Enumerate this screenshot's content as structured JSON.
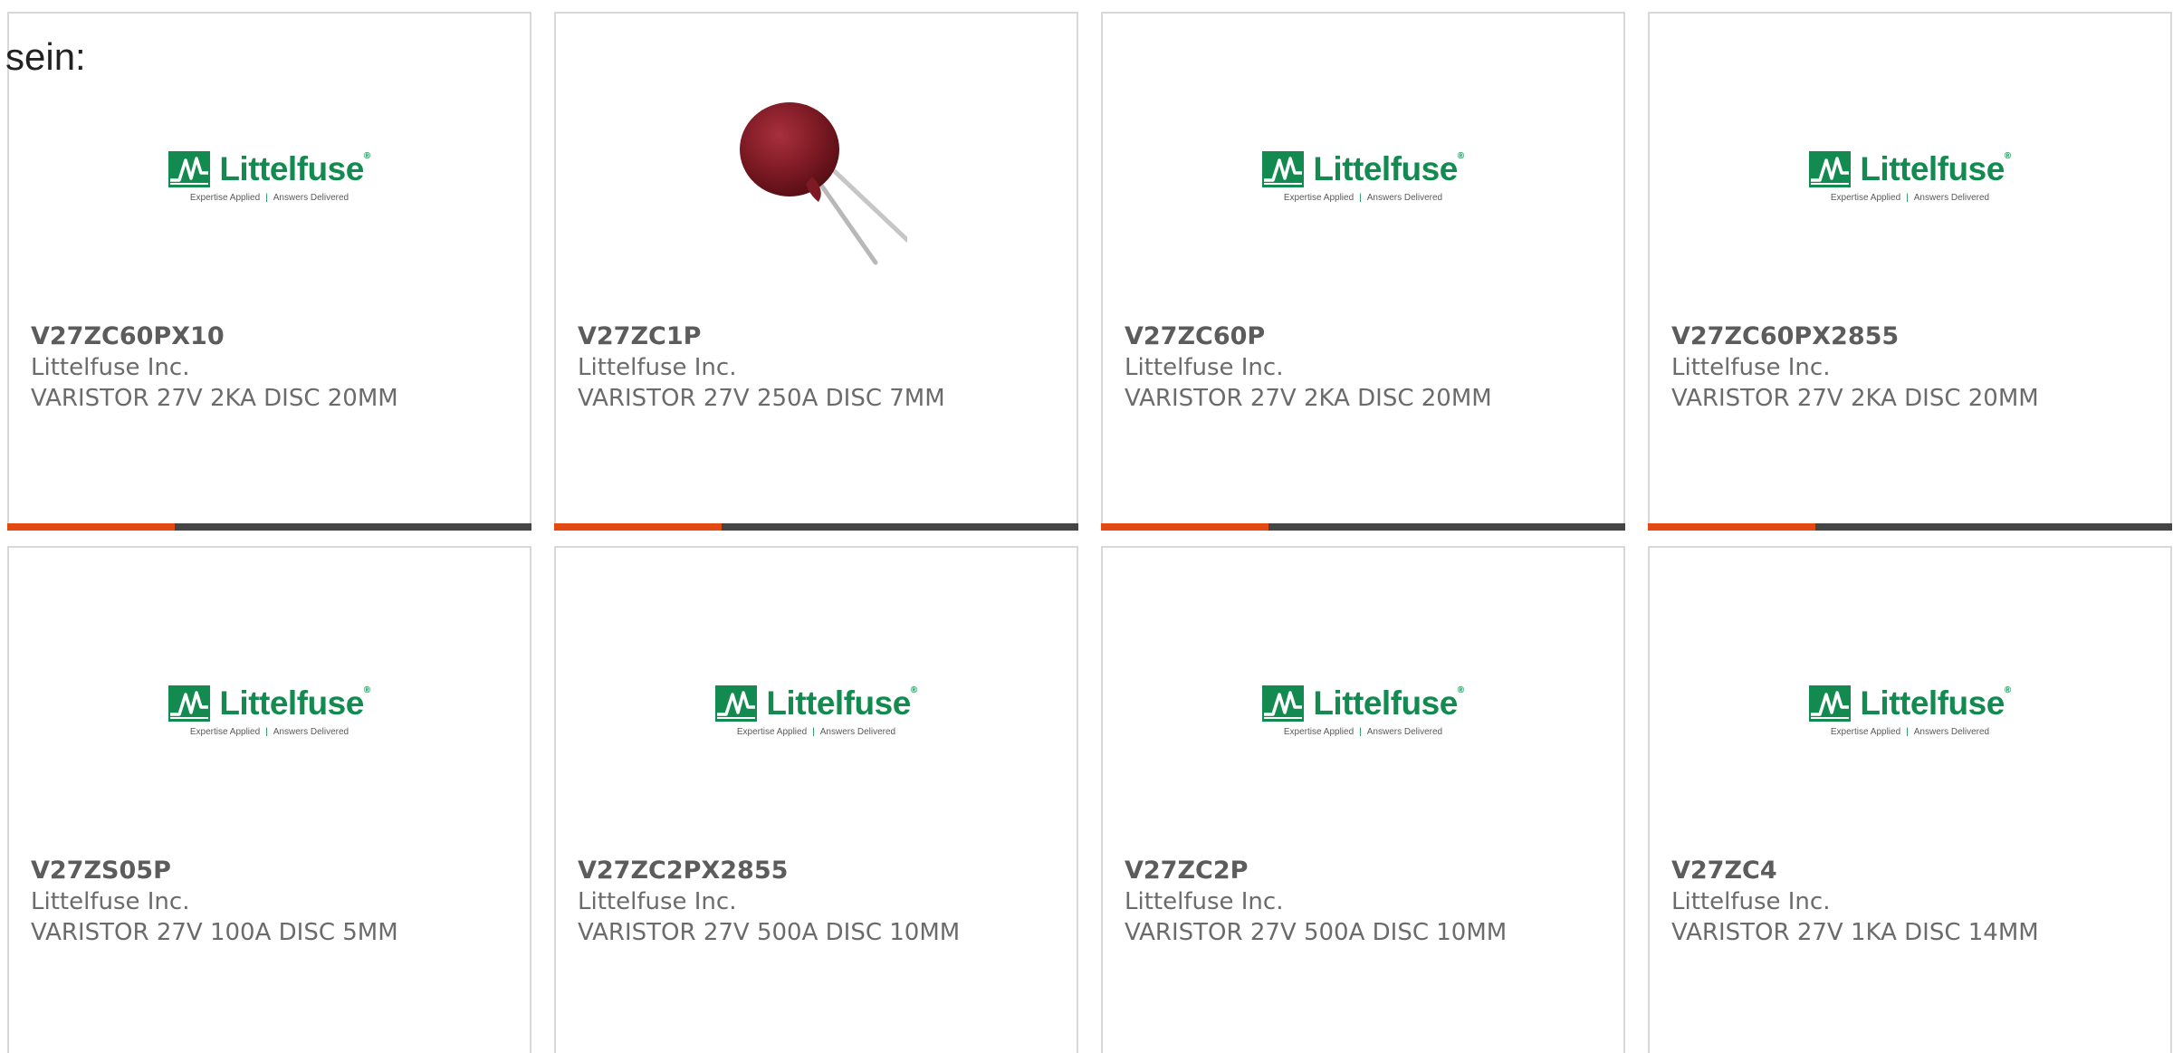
{
  "intro_text": "sein:",
  "colors": {
    "accent": "#e34a13",
    "bar": "#454545",
    "brand_green": "#138a4f",
    "border": "#d8d8d8"
  },
  "logo": {
    "wordmark": "Littelfuse",
    "registered": "®",
    "tagline_left": "Expertise Applied",
    "tagline_sep": "|",
    "tagline_right": "Answers Delivered"
  },
  "products": [
    {
      "part_number": "V27ZC60PX10",
      "manufacturer": "Littelfuse Inc.",
      "description": "VARISTOR 27V 2KA DISC 20MM",
      "image": "littelfuse-logo",
      "progress": 0.32
    },
    {
      "part_number": "V27ZC1P",
      "manufacturer": "Littelfuse Inc.",
      "description": "VARISTOR 27V 250A DISC 7MM",
      "image": "varistor-photo",
      "progress": 0.32
    },
    {
      "part_number": "V27ZC60P",
      "manufacturer": "Littelfuse Inc.",
      "description": "VARISTOR 27V 2KA DISC 20MM",
      "image": "littelfuse-logo",
      "progress": 0.32
    },
    {
      "part_number": "V27ZC60PX2855",
      "manufacturer": "Littelfuse Inc.",
      "description": "VARISTOR 27V 2KA DISC 20MM",
      "image": "littelfuse-logo",
      "progress": 0.32
    },
    {
      "part_number": "V27ZS05P",
      "manufacturer": "Littelfuse Inc.",
      "description": "VARISTOR 27V 100A DISC 5MM",
      "image": "littelfuse-logo"
    },
    {
      "part_number": "V27ZC2PX2855",
      "manufacturer": "Littelfuse Inc.",
      "description": "VARISTOR 27V 500A DISC 10MM",
      "image": "littelfuse-logo"
    },
    {
      "part_number": "V27ZC2P",
      "manufacturer": "Littelfuse Inc.",
      "description": "VARISTOR 27V 500A DISC 10MM",
      "image": "littelfuse-logo"
    },
    {
      "part_number": "V27ZC4",
      "manufacturer": "Littelfuse Inc.",
      "description": "VARISTOR 27V 1KA DISC 14MM",
      "image": "littelfuse-logo"
    }
  ]
}
